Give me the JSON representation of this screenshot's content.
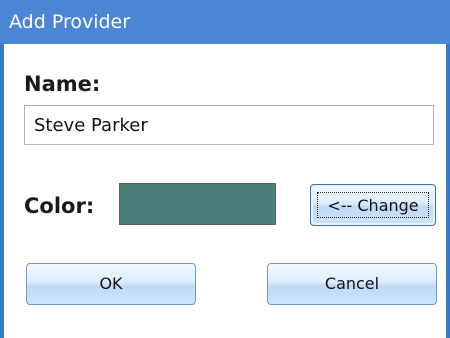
{
  "window": {
    "title": "Add Provider"
  },
  "form": {
    "name_label": "Name:",
    "name_value": "Steve Parker",
    "color_label": "Color:",
    "color_value": "#4a7f7c",
    "change_label": "<-- Change"
  },
  "buttons": {
    "ok_label": "OK",
    "cancel_label": "Cancel"
  },
  "colors": {
    "titlebar": "#4a86d3",
    "frame": "#3a79c8"
  }
}
